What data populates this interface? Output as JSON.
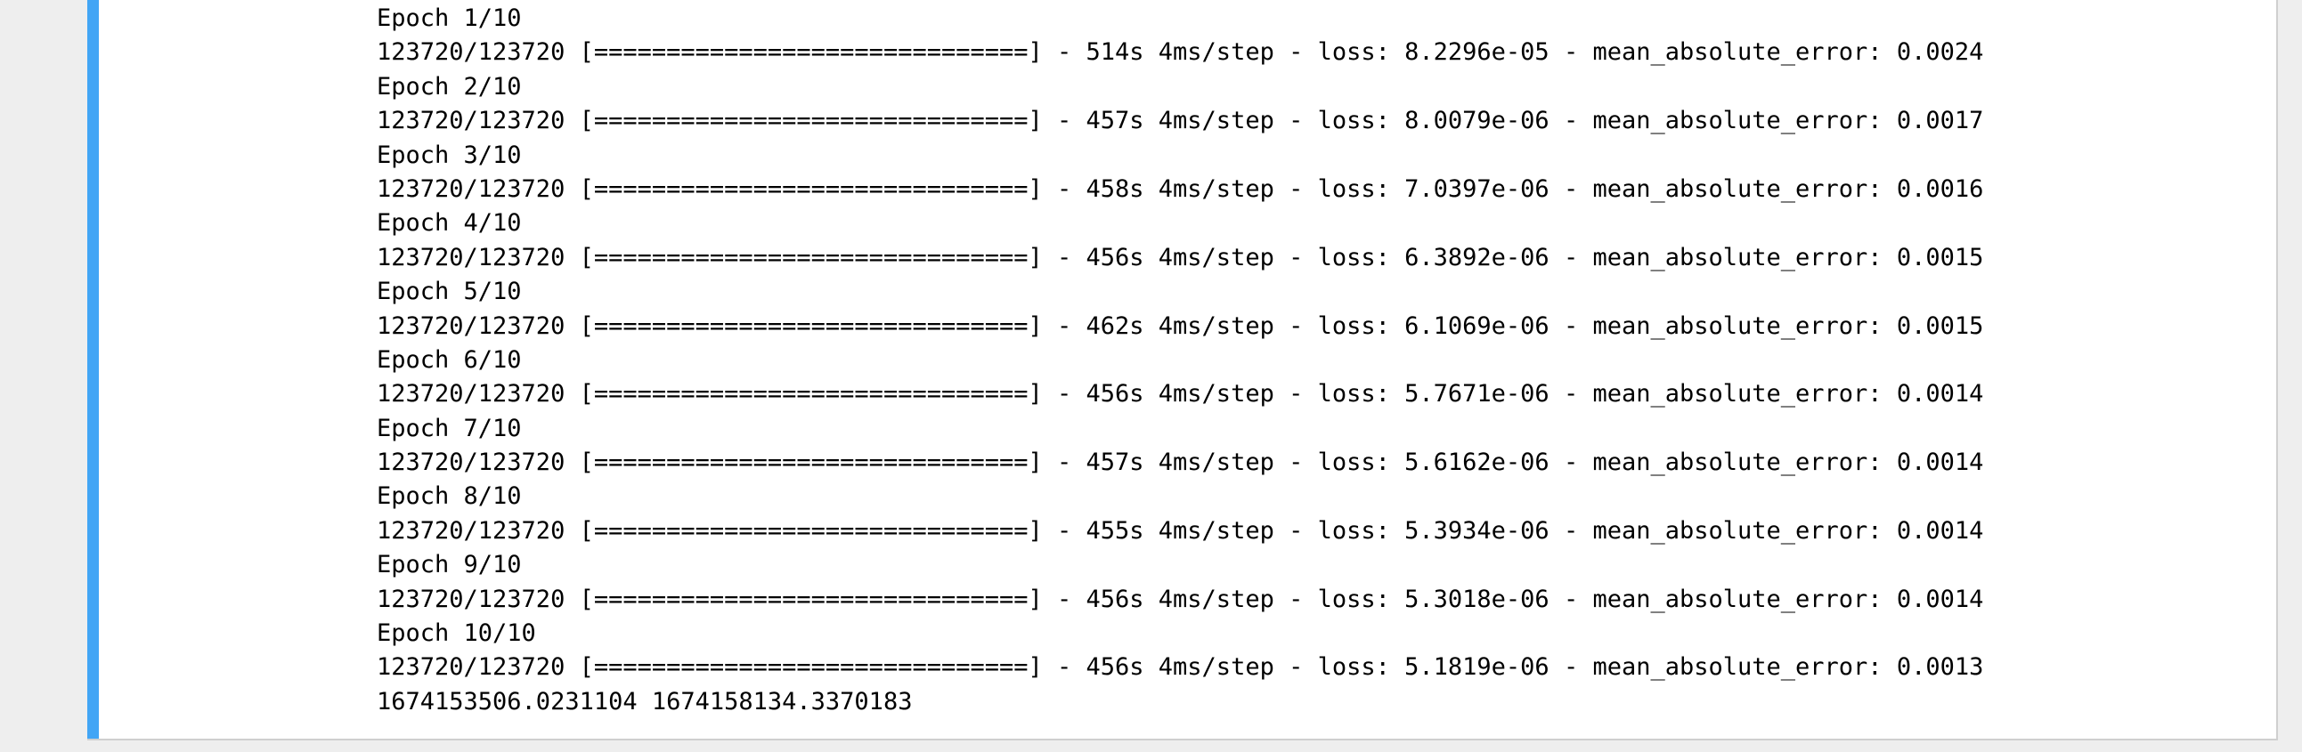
{
  "output": {
    "lines": [
      "Epoch 1/10",
      "123720/123720 [==============================] - 514s 4ms/step - loss: 8.2296e-05 - mean_absolute_error: 0.0024",
      "Epoch 2/10",
      "123720/123720 [==============================] - 457s 4ms/step - loss: 8.0079e-06 - mean_absolute_error: 0.0017",
      "Epoch 3/10",
      "123720/123720 [==============================] - 458s 4ms/step - loss: 7.0397e-06 - mean_absolute_error: 0.0016",
      "Epoch 4/10",
      "123720/123720 [==============================] - 456s 4ms/step - loss: 6.3892e-06 - mean_absolute_error: 0.0015",
      "Epoch 5/10",
      "123720/123720 [==============================] - 462s 4ms/step - loss: 6.1069e-06 - mean_absolute_error: 0.0015",
      "Epoch 6/10",
      "123720/123720 [==============================] - 456s 4ms/step - loss: 5.7671e-06 - mean_absolute_error: 0.0014",
      "Epoch 7/10",
      "123720/123720 [==============================] - 457s 4ms/step - loss: 5.6162e-06 - mean_absolute_error: 0.0014",
      "Epoch 8/10",
      "123720/123720 [==============================] - 455s 4ms/step - loss: 5.3934e-06 - mean_absolute_error: 0.0014",
      "Epoch 9/10",
      "123720/123720 [==============================] - 456s 4ms/step - loss: 5.3018e-06 - mean_absolute_error: 0.0014",
      "Epoch 10/10",
      "123720/123720 [==============================] - 456s 4ms/step - loss: 5.1819e-06 - mean_absolute_error: 0.0013",
      "1674153506.0231104 1674158134.3370183"
    ]
  },
  "colors": {
    "page_background": "#eeeeee",
    "cell_background": "#ffffff",
    "cell_accent": "#42a5f5",
    "cell_border": "#cfcfcf",
    "text": "#000000"
  }
}
